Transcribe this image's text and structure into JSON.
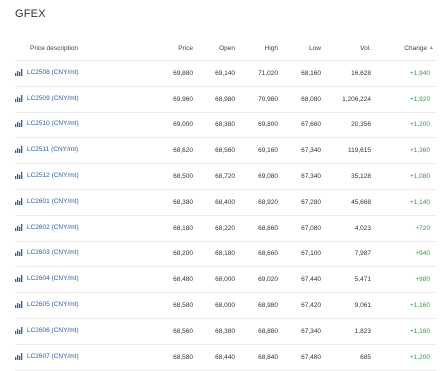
{
  "page_title": "GFEX",
  "table": {
    "headers": {
      "description": "Price description",
      "price": "Price",
      "open": "Open",
      "high": "High",
      "low": "Low",
      "vol": "Vol.",
      "change": "Change"
    },
    "sort_icon": "sort-arrow-icon",
    "row_icon": "bar-chart-icon",
    "colors": {
      "link": "#2a5db0",
      "positive": "#2e9e46"
    },
    "rows": [
      {
        "name": "LC2508 (CNY/mt)",
        "price": "69,880",
        "open": "69,140",
        "high": "71,020",
        "low": "68,160",
        "vol": "16,628",
        "change": "+1,940"
      },
      {
        "name": "LC2509 (CNY/mt)",
        "price": "69,960",
        "open": "68,980",
        "high": "70,980",
        "low": "68,080",
        "vol": "1,206,224",
        "change": "+1,920"
      },
      {
        "name": "LC2510 (CNY/mt)",
        "price": "69,000",
        "open": "68,380",
        "high": "69,800",
        "low": "67,660",
        "vol": "20,356",
        "change": "+1,200"
      },
      {
        "name": "LC2511 (CNY/mt)",
        "price": "68,620",
        "open": "68,560",
        "high": "69,160",
        "low": "67,340",
        "vol": "119,615",
        "change": "+1,360"
      },
      {
        "name": "LC2512 (CNY/mt)",
        "price": "68,500",
        "open": "68,720",
        "high": "69,080",
        "low": "67,340",
        "vol": "35,128",
        "change": "+1,080"
      },
      {
        "name": "LC2601 (CNY/mt)",
        "price": "68,380",
        "open": "68,400",
        "high": "68,920",
        "low": "67,280",
        "vol": "45,668",
        "change": "+1,140"
      },
      {
        "name": "LC2602 (CNY/mt)",
        "price": "68,180",
        "open": "68,220",
        "high": "68,860",
        "low": "67,080",
        "vol": "4,023",
        "change": "+720"
      },
      {
        "name": "LC2603 (CNY/mt)",
        "price": "68,200",
        "open": "68,180",
        "high": "68,660",
        "low": "67,100",
        "vol": "7,987",
        "change": "+940"
      },
      {
        "name": "LC2604 (CNY/mt)",
        "price": "68,480",
        "open": "68,000",
        "high": "69,020",
        "low": "67,440",
        "vol": "5,471",
        "change": "+980"
      },
      {
        "name": "LC2605 (CNY/mt)",
        "price": "68,580",
        "open": "68,000",
        "high": "68,980",
        "low": "67,420",
        "vol": "9,061",
        "change": "+1,160"
      },
      {
        "name": "LC2606 (CNY/mt)",
        "price": "68,560",
        "open": "68,380",
        "high": "68,880",
        "low": "67,340",
        "vol": "1,823",
        "change": "+1,160"
      },
      {
        "name": "LC2607 (CNY/mt)",
        "price": "68,580",
        "open": "68,440",
        "high": "68,840",
        "low": "67,480",
        "vol": "685",
        "change": "+1,200"
      }
    ]
  }
}
